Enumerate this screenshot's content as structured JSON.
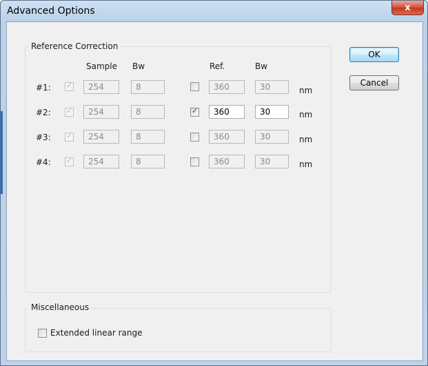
{
  "window": {
    "title": "Advanced Options",
    "close_glyph": "x"
  },
  "reference_correction": {
    "title": "Reference Correction",
    "headers": {
      "sample": "Sample",
      "bw1": "Bw",
      "ref": "Ref.",
      "bw2": "Bw"
    },
    "rows": [
      {
        "label": "#1:",
        "sample_checked": true,
        "sample": "254",
        "bw": "8",
        "ref_checked": false,
        "ref": "360",
        "ref_bw": "30",
        "unit": "nm"
      },
      {
        "label": "#2:",
        "sample_checked": true,
        "sample": "254",
        "bw": "8",
        "ref_checked": true,
        "ref": "360",
        "ref_bw": "30",
        "unit": "nm"
      },
      {
        "label": "#3:",
        "sample_checked": true,
        "sample": "254",
        "bw": "8",
        "ref_checked": false,
        "ref": "360",
        "ref_bw": "30",
        "unit": "nm"
      },
      {
        "label": "#4:",
        "sample_checked": true,
        "sample": "254",
        "bw": "8",
        "ref_checked": false,
        "ref": "360",
        "ref_bw": "30",
        "unit": "nm"
      }
    ]
  },
  "miscellaneous": {
    "title": "Miscellaneous",
    "extended_linear_range_label": "Extended linear range",
    "extended_linear_range_checked": false
  },
  "buttons": {
    "ok": "OK",
    "cancel": "Cancel"
  },
  "icons": {
    "check": "checkmark-icon",
    "close": "close-icon"
  },
  "colors": {
    "title_bar": "#b9d1ea",
    "dialog_bg": "#f0f0f0",
    "close_button": "#c3391f"
  }
}
